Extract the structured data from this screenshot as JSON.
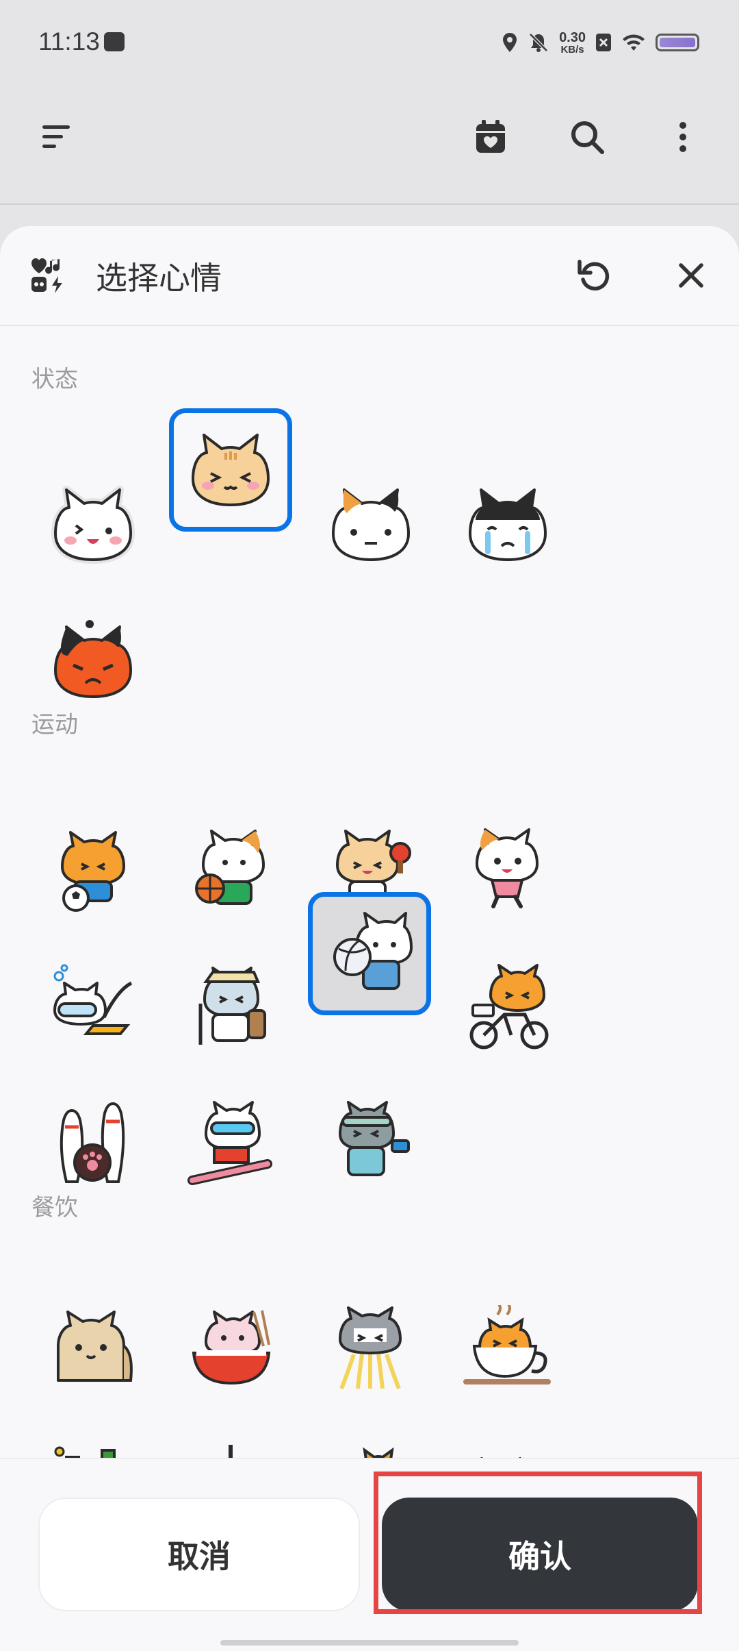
{
  "status_bar": {
    "time": "11:13",
    "speed_value": "0.30",
    "speed_unit": "KB/s"
  },
  "sheet": {
    "title": "选择心情"
  },
  "sections": [
    {
      "label": "状态",
      "stickers": [
        "happy-cat-sticker",
        "squinting-tabby-cat-sticker",
        "calico-cat-sticker",
        "crying-cat-sticker",
        "angry-cat-sticker"
      ]
    },
    {
      "label": "运动",
      "stickers": [
        "soccer-cat-sticker",
        "basketball-cat-sticker",
        "ping-pong-cat-sticker",
        "running-cat-sticker",
        "diving-cat-sticker",
        "hiking-cat-sticker",
        "volleyball-cat-sticker",
        "cycling-cat-sticker",
        "bowling-cat-sticker",
        "snowboard-cat-sticker",
        "weightlifting-cat-sticker"
      ]
    },
    {
      "label": "餐饮",
      "stickers": [
        "bread-cat-sticker",
        "noodle-bowl-cat-sticker",
        "ramen-cat-sticker",
        "coffee-cup-cat-sticker",
        "beer-cat-sticker",
        "bubble-tea-cat-sticker",
        "pizza-cat-sticker",
        "chicken-leg-cat-sticker"
      ]
    }
  ],
  "selected": [
    "squinting-tabby-cat-sticker",
    "volleyball-cat-sticker"
  ],
  "buttons": {
    "cancel": "取消",
    "confirm": "确认"
  },
  "colors": {
    "selection": "#0a73e6",
    "confirm_bg": "#33363b",
    "highlight": "#e64545"
  }
}
